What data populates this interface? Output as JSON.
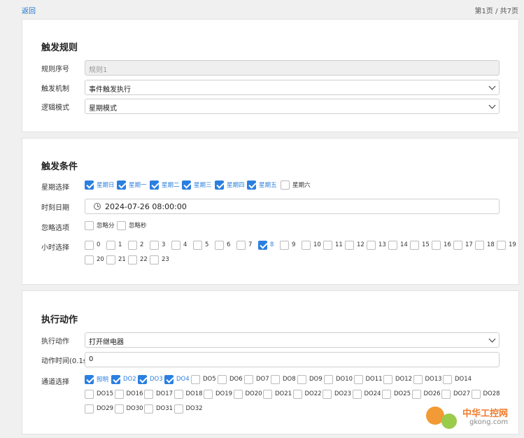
{
  "topbar": {
    "back": "返回",
    "page_info": "第1页 / 共7页"
  },
  "trigger_rule": {
    "title": "触发规则",
    "rule_no_label": "规则序号",
    "rule_no_value": "规则1",
    "mechanism_label": "触发机制",
    "mechanism_value": "事件触发执行",
    "logic_label": "逻辑模式",
    "logic_value": "星期模式"
  },
  "trigger_cond": {
    "title": "触发条件",
    "week_label": "星期选择",
    "weekdays": [
      {
        "label": "星期日",
        "checked": true
      },
      {
        "label": "星期一",
        "checked": true
      },
      {
        "label": "星期二",
        "checked": true
      },
      {
        "label": "星期三",
        "checked": true
      },
      {
        "label": "星期四",
        "checked": true
      },
      {
        "label": "星期五",
        "checked": true
      },
      {
        "label": "星期六",
        "checked": false
      }
    ],
    "datetime_label": "时刻日期",
    "datetime_value": "2024-07-26 08:00:00",
    "ignore_label": "忽略选项",
    "ignore_opts": [
      {
        "label": "忽略分",
        "checked": false
      },
      {
        "label": "忽略秒",
        "checked": false
      }
    ],
    "hour_label": "小时选择",
    "hours": [
      "0",
      "1",
      "2",
      "3",
      "4",
      "5",
      "6",
      "7",
      "8",
      "9",
      "10",
      "11",
      "12",
      "13",
      "14",
      "15",
      "16",
      "17",
      "18",
      "19",
      "20",
      "21",
      "22",
      "23"
    ],
    "hours_checked": [
      "8"
    ]
  },
  "action": {
    "title": "执行动作",
    "action_label": "执行动作",
    "action_value": "打开继电器",
    "time_label": "动作时间(0.1s)",
    "time_value": "0",
    "channel_label": "通道选择",
    "channels": [
      "照明",
      "DO2",
      "DO3",
      "DO4",
      "DO5",
      "DO6",
      "DO7",
      "DO8",
      "DO9",
      "DO10",
      "DO11",
      "DO12",
      "DO13",
      "DO14",
      "DO15",
      "DO16",
      "DO17",
      "DO18",
      "DO19",
      "DO20",
      "DO21",
      "DO22",
      "DO23",
      "DO24",
      "DO25",
      "DO26",
      "DO27",
      "DO28",
      "DO29",
      "DO30",
      "DO31",
      "DO32"
    ],
    "channels_checked": [
      "照明",
      "DO2",
      "DO3",
      "DO4"
    ]
  },
  "watermark": {
    "line1": "中华工控网",
    "line2": "gkong.com"
  }
}
